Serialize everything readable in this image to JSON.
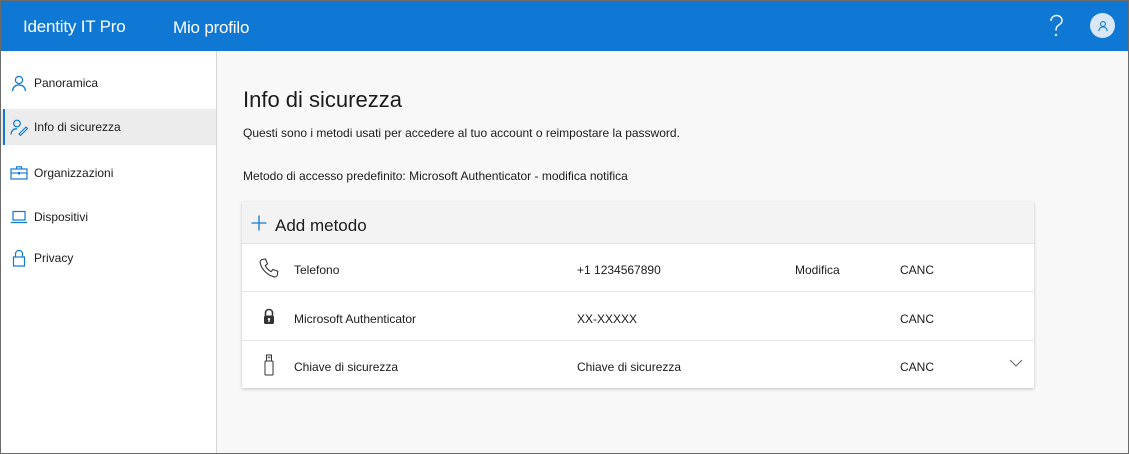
{
  "header": {
    "brand": "Identity IT Pro",
    "profile_link": "Mio profilo",
    "help_icon": "question-mark-icon",
    "avatar_icon": "person-icon",
    "accent_color": "#0f78d4"
  },
  "sidebar": {
    "items": [
      {
        "label": "Panoramica",
        "icon": "person-icon",
        "active": false
      },
      {
        "label": "Info di sicurezza",
        "icon": "person-key-icon",
        "active": true
      },
      {
        "label": "Organizzazioni",
        "icon": "briefcase-icon",
        "active": false
      },
      {
        "label": "Dispositivi",
        "icon": "laptop-icon",
        "active": false
      },
      {
        "label": "Privacy",
        "icon": "lock-icon",
        "active": false
      }
    ]
  },
  "main": {
    "title": "Info di sicurezza",
    "description": "Questi sono i metodi usati per accedere al tuo account o reimpostare la password.",
    "default_method": "Metodo di accesso predefinito: Microsoft Authenticator - modifica notifica",
    "add_method_label": "Add metodo",
    "methods": [
      {
        "icon": "phone-icon",
        "name": "Telefono",
        "value": "+1 1234567890",
        "edit": "Modifica",
        "delete": "CANC"
      },
      {
        "icon": "authenticator-lock-icon",
        "name": "Microsoft Authenticator",
        "value": "XX-XXXXX",
        "edit": "",
        "delete": "CANC"
      },
      {
        "icon": "usb-key-icon",
        "name": "Chiave di sicurezza",
        "value": "Chiave di sicurezza",
        "edit": "",
        "delete": "CANC",
        "expand_icon": "chevron-down-icon"
      }
    ]
  }
}
